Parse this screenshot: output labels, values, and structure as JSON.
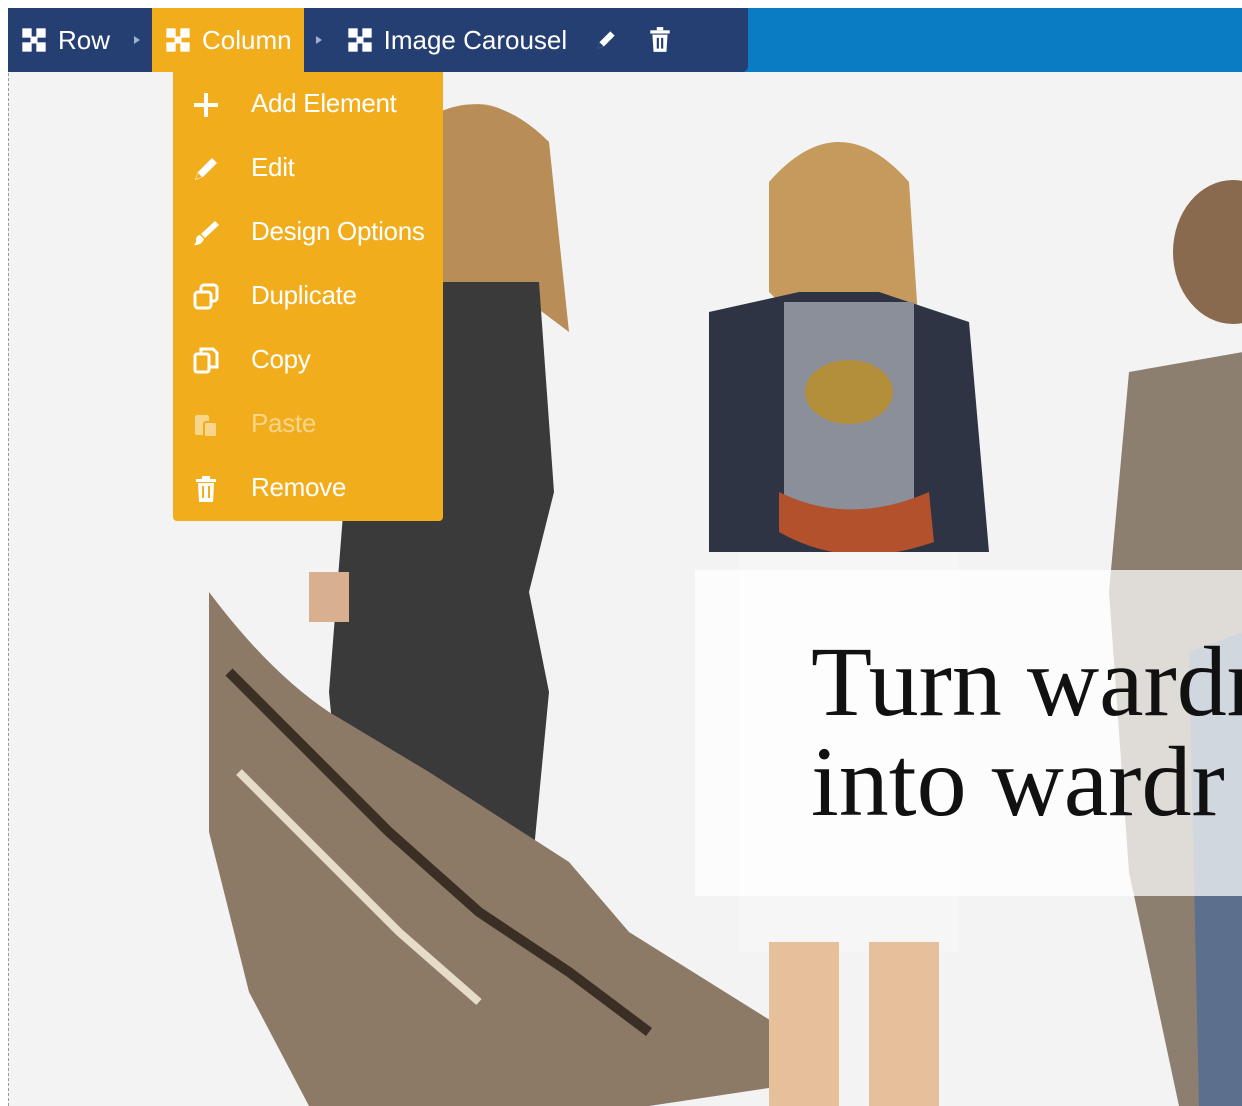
{
  "toolbar": {
    "items": [
      {
        "label": "Row",
        "icon": "move-icon"
      },
      {
        "label": "Column",
        "icon": "move-icon",
        "active": true
      },
      {
        "label": "Image Carousel",
        "icon": "move-icon"
      }
    ],
    "actions": [
      {
        "icon": "pencil-icon"
      },
      {
        "icon": "trash-icon"
      }
    ]
  },
  "column_menu": {
    "items": [
      {
        "label": "Add Element",
        "icon": "plus-icon"
      },
      {
        "label": "Edit",
        "icon": "pencil-icon"
      },
      {
        "label": "Design Options",
        "icon": "brush-icon"
      },
      {
        "label": "Duplicate",
        "icon": "duplicate-icon"
      },
      {
        "label": "Copy",
        "icon": "copy-icon"
      },
      {
        "label": "Paste",
        "icon": "paste-icon",
        "disabled": true
      },
      {
        "label": "Remove",
        "icon": "trash-icon"
      }
    ]
  },
  "hero": {
    "heading_line1": "Turn wardr",
    "heading_line2": "into wardr"
  },
  "colors": {
    "toolbar_bg": "#263f73",
    "active_accent": "#f2ad1d",
    "top_band": "#0a7cc4",
    "text_white": "#ffffff"
  }
}
